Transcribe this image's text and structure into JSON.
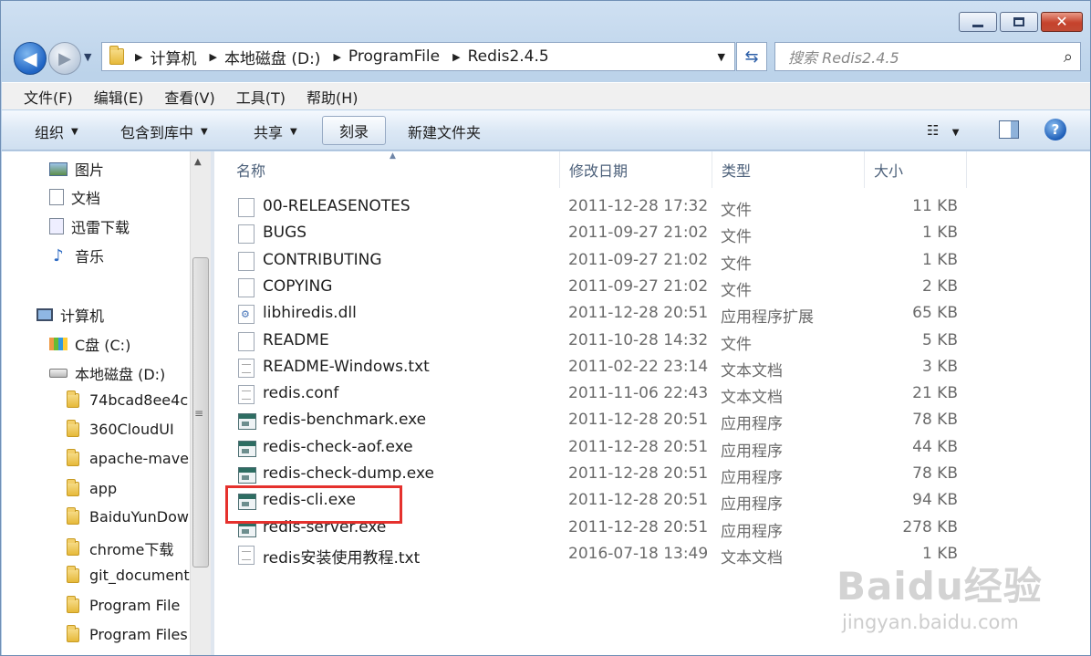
{
  "window": {
    "min_icon": "minimize-icon",
    "max_icon": "maximize-icon",
    "close_icon": "close-icon"
  },
  "address": {
    "crumbs": [
      "计算机",
      "本地磁盘 (D:)",
      "ProgramFile",
      "Redis2.4.5"
    ]
  },
  "search": {
    "placeholder": "搜索 Redis2.4.5"
  },
  "menu": [
    "文件(F)",
    "编辑(E)",
    "查看(V)",
    "工具(T)",
    "帮助(H)"
  ],
  "toolbar": {
    "organize": "组织",
    "include_library": "包含到库中",
    "share": "共享",
    "burn": "刻录",
    "new_folder": "新建文件夹"
  },
  "nav": {
    "favorites": [
      "图片",
      "文档",
      "迅雷下载",
      "音乐"
    ],
    "computer": "计算机",
    "drives": [
      "C盘 (C:)",
      "本地磁盘 (D:)"
    ],
    "folders": [
      "74bcad8ee4c",
      "360CloudUI",
      "apache-mave",
      "app",
      "BaiduYunDow",
      "chrome下载",
      "git_document",
      "Program File",
      "Program Files"
    ]
  },
  "columns": {
    "name": "名称",
    "date": "修改日期",
    "type": "类型",
    "size": "大小"
  },
  "files": [
    {
      "name": "00-RELEASENOTES",
      "date": "2011-12-28 17:32",
      "type": "文件",
      "size": "11 KB",
      "icon": "file"
    },
    {
      "name": "BUGS",
      "date": "2011-09-27 21:02",
      "type": "文件",
      "size": "1 KB",
      "icon": "file"
    },
    {
      "name": "CONTRIBUTING",
      "date": "2011-09-27 21:02",
      "type": "文件",
      "size": "1 KB",
      "icon": "file"
    },
    {
      "name": "COPYING",
      "date": "2011-09-27 21:02",
      "type": "文件",
      "size": "2 KB",
      "icon": "file"
    },
    {
      "name": "libhiredis.dll",
      "date": "2011-12-28 20:51",
      "type": "应用程序扩展",
      "size": "65 KB",
      "icon": "dll"
    },
    {
      "name": "README",
      "date": "2011-10-28 14:32",
      "type": "文件",
      "size": "5 KB",
      "icon": "file"
    },
    {
      "name": "README-Windows.txt",
      "date": "2011-02-22 23:14",
      "type": "文本文档",
      "size": "3 KB",
      "icon": "txt"
    },
    {
      "name": "redis.conf",
      "date": "2011-11-06 22:43",
      "type": "文本文档",
      "size": "21 KB",
      "icon": "txt"
    },
    {
      "name": "redis-benchmark.exe",
      "date": "2011-12-28 20:51",
      "type": "应用程序",
      "size": "78 KB",
      "icon": "exe"
    },
    {
      "name": "redis-check-aof.exe",
      "date": "2011-12-28 20:51",
      "type": "应用程序",
      "size": "44 KB",
      "icon": "exe"
    },
    {
      "name": "redis-check-dump.exe",
      "date": "2011-12-28 20:51",
      "type": "应用程序",
      "size": "78 KB",
      "icon": "exe"
    },
    {
      "name": "redis-cli.exe",
      "date": "2011-12-28 20:51",
      "type": "应用程序",
      "size": "94 KB",
      "icon": "exe"
    },
    {
      "name": "redis-server.exe",
      "date": "2011-12-28 20:51",
      "type": "应用程序",
      "size": "278 KB",
      "icon": "exe"
    },
    {
      "name": "redis安装使用教程.txt",
      "date": "2016-07-18 13:49",
      "type": "文本文档",
      "size": "1 KB",
      "icon": "txt"
    }
  ],
  "highlight_color": "#e5312d",
  "watermark": {
    "logo": "Baidu经验",
    "url": "jingyan.baidu.com"
  }
}
